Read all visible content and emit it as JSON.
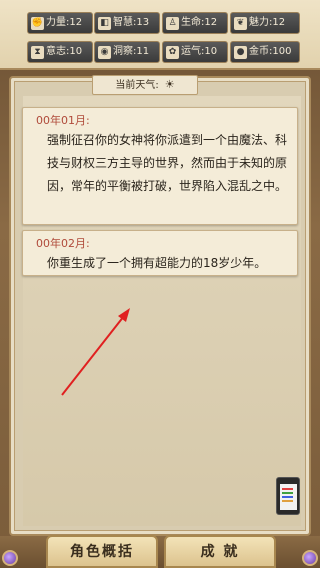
{
  "stats": [
    {
      "icon": "fist-icon",
      "glyph": "✊",
      "label": "力量",
      "value": "12"
    },
    {
      "icon": "book-icon",
      "glyph": "◧",
      "label": "智慧",
      "value": "13"
    },
    {
      "icon": "person-icon",
      "glyph": "♙",
      "label": "生命",
      "value": "12"
    },
    {
      "icon": "charm-icon",
      "glyph": "❦",
      "label": "魅力",
      "value": "12"
    },
    {
      "icon": "hourglass-icon",
      "glyph": "⧗",
      "label": "意志",
      "value": "10"
    },
    {
      "icon": "eye-icon",
      "glyph": "◉",
      "label": "洞察",
      "value": "11"
    },
    {
      "icon": "luck-icon",
      "glyph": "✿",
      "label": "运气",
      "value": "10"
    },
    {
      "icon": "coin-icon",
      "glyph": "●",
      "label": "金币",
      "value": "100"
    }
  ],
  "weather": {
    "label": "当前天气:",
    "icon": "sun-icon"
  },
  "entries": [
    {
      "date": "00年01月:",
      "text": "强制征召你的女神将你派遣到一个由魔法、科技与财权三方主导的世界，然而由于未知的原因，常年的平衡被打破，世界陷入混乱之中。"
    },
    {
      "date": "00年02月:",
      "text": "你重生成了一个拥有超能力的18岁少年。"
    }
  ],
  "buttons": {
    "left": "角色概括",
    "right": "成 就"
  },
  "colors": {
    "arrow": "#e02020",
    "date": "#b04a3a"
  }
}
